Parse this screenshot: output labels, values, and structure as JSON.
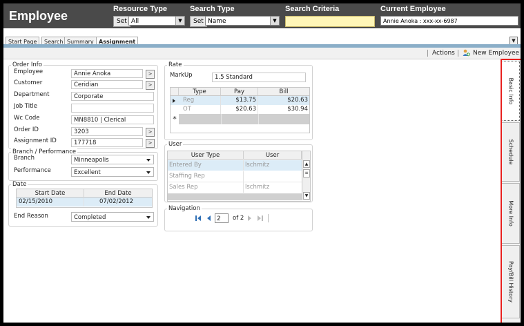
{
  "header": {
    "app_title": "Employee",
    "resource_type_label": "Resource Type",
    "resource_type_set": "Set",
    "resource_type_value": "All",
    "search_type_label": "Search Type",
    "search_type_set": "Set",
    "search_type_value": "Name",
    "search_criteria_label": "Search Criteria",
    "search_criteria_value": "",
    "current_employee_label": "Current Employee",
    "current_employee_value": "Annie Anoka : xxx-xx-6987"
  },
  "tabs": [
    {
      "label": "Start Page"
    },
    {
      "label": "Search"
    },
    {
      "label": "Summary"
    },
    {
      "label": "Assignment",
      "active": true
    }
  ],
  "toolbar": {
    "actions_label": "Actions",
    "new_employee_label": "New Employee"
  },
  "order_info": {
    "title": "Order Info",
    "employee_label": "Employee",
    "employee_value": "Annie  Anoka",
    "customer_label": "Customer",
    "customer_value": "Ceridian",
    "department_label": "Department",
    "department_value": "Corporate",
    "job_title_label": "Job Title",
    "job_title_value": "",
    "wc_code_label": "Wc Code",
    "wc_code_value": "MN8810 | Clerical",
    "order_id_label": "Order ID",
    "order_id_value": "3203",
    "assignment_id_label": "Assignment ID",
    "assignment_id_value": "177718",
    "go_glyph": ">"
  },
  "branch": {
    "title": "Branch / Performance",
    "branch_label": "Branch",
    "branch_value": "Minneapolis",
    "performance_label": "Performance",
    "performance_value": "Excellent"
  },
  "date": {
    "title": "Date",
    "start_header": "Start Date",
    "end_header": "End Date",
    "start_value": "02/15/2010",
    "end_value": "07/02/2012",
    "end_reason_label": "End Reason",
    "end_reason_value": "Completed"
  },
  "rate": {
    "title": "Rate",
    "markup_label": "MarkUp",
    "markup_value": "1.5 Standard",
    "columns": [
      "Type",
      "Pay",
      "Bill"
    ],
    "rows": [
      {
        "type": "Reg",
        "pay": "$13.75",
        "bill": "$20.63"
      },
      {
        "type": "OT",
        "pay": "$20.63",
        "bill": "$30.94"
      }
    ],
    "new_row_marker": "*"
  },
  "user": {
    "title": "User",
    "columns": [
      "User Type",
      "User"
    ],
    "rows": [
      {
        "type": "Entered By",
        "user": "lschmitz"
      },
      {
        "type": "Staffing Rep",
        "user": ""
      },
      {
        "type": "Sales Rep",
        "user": "lschmitz"
      }
    ]
  },
  "navigation": {
    "title": "Navigation",
    "page_value": "2",
    "page_of": "of 2"
  },
  "side_tabs": [
    {
      "label": "Basic Info",
      "active": true
    },
    {
      "label": "Schedule"
    },
    {
      "label": "More Info"
    },
    {
      "label": "Pay/Bill History"
    }
  ],
  "colors": {
    "header_bg": "#4a4a4a",
    "tab_band": "#8aaec8",
    "highlight": "#e8201e",
    "criteria_bg": "#fff6b8",
    "selected_row": "#dcecf7"
  }
}
